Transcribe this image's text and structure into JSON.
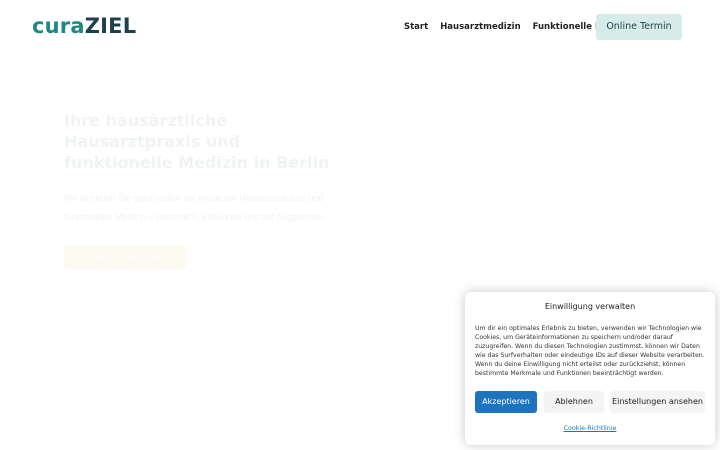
{
  "header": {
    "logo_part1": "cura",
    "logo_part2": "ZIEL",
    "nav": [
      "Start",
      "Hausarztmedizin",
      "Funktionelle Medizin"
    ],
    "cta_label": "Online Termin"
  },
  "hero": {
    "title": "Ihre hausärztliche Hausarztpraxis und funktionelle Medizin in Berlin",
    "text": "Wir betreuen Sie ganzheitlich mit moderner Hausarztmedizin und funktioneller Medizin – persönlich, individuell und auf Augenhöhe.",
    "button_label": "Online Termin buchen"
  },
  "consent": {
    "title": "Einwilligung verwalten",
    "body": "Um dir ein optimales Erlebnis zu bieten, verwenden wir Technologien wie Cookies, um Geräteinformationen zu speichern und/oder darauf zuzugreifen. Wenn du diesen Technologien zustimmst, können wir Daten wie das Surfverhalten oder eindeutige IDs auf dieser Website verarbeiten. Wenn du deine Einwilligung nicht erteilst oder zurückziehst, können bestimmte Merkmale und Funktionen beeinträchtigt werden.",
    "accept_label": "Akzeptieren",
    "deny_label": "Ablehnen",
    "settings_label": "Einstellungen ansehen",
    "policy_link": "Cookie-Richtlinie"
  },
  "colors": {
    "brand_teal": "#1c8a80",
    "brand_dark": "#1e3f4e",
    "cta_bg": "#d5ece8",
    "accept_blue": "#1e73be"
  }
}
